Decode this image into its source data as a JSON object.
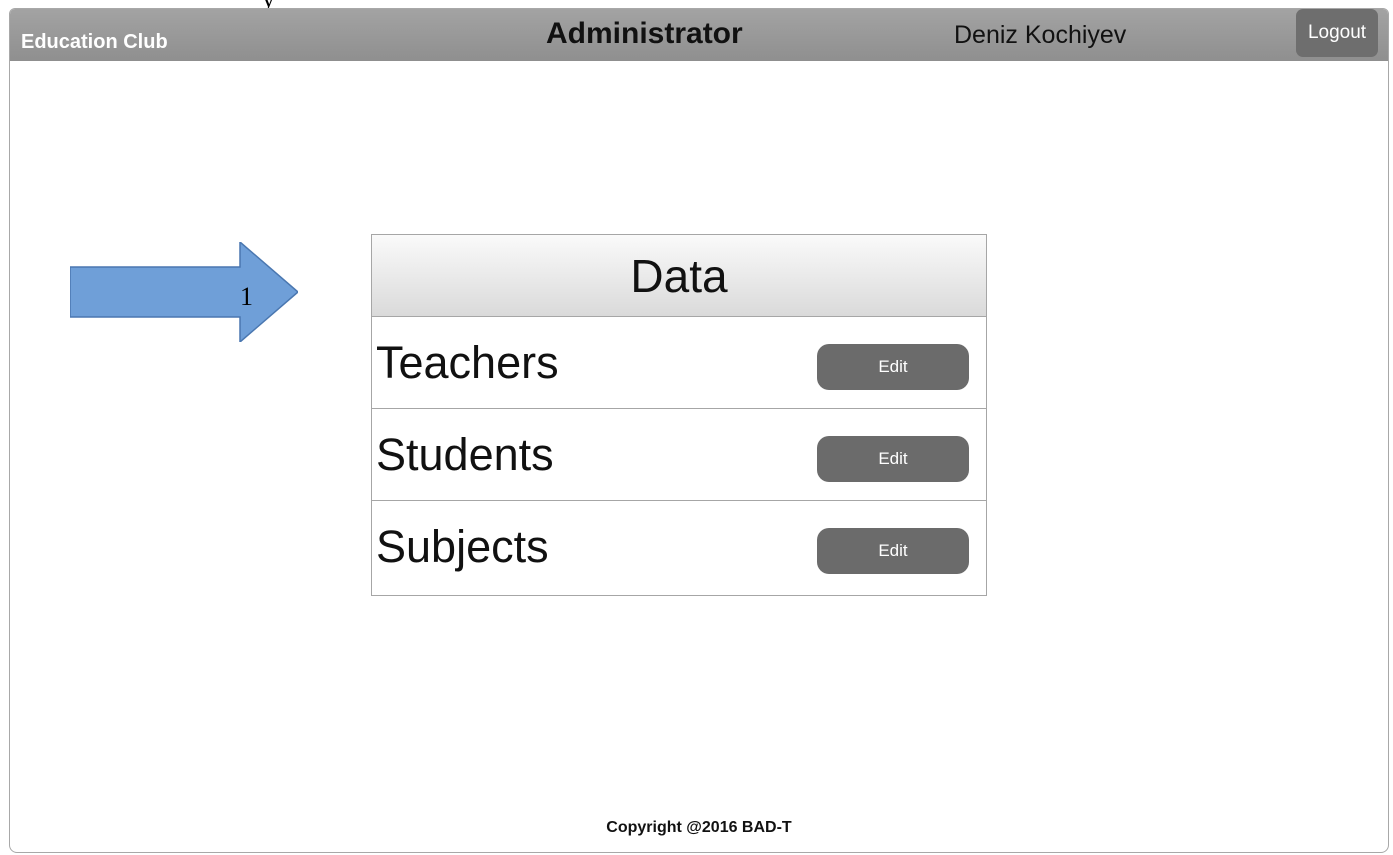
{
  "header": {
    "brand": "Education Club",
    "role_title": "Administrator",
    "user_name": "Deniz Kochiyev",
    "logout_label": "Logout"
  },
  "annotation": {
    "stray_glyph": "y",
    "arrow_label": "1",
    "arrow_color": "#6f9fd8"
  },
  "panel": {
    "title": "Data",
    "rows": [
      {
        "label": "Teachers",
        "button": "Edit"
      },
      {
        "label": "Students",
        "button": "Edit"
      },
      {
        "label": "Subjects",
        "button": "Edit"
      }
    ]
  },
  "footer": {
    "copyright": "Copyright @2016 BAD-T"
  },
  "colors": {
    "topbar": "#999999",
    "button": "#6b6b6b"
  }
}
